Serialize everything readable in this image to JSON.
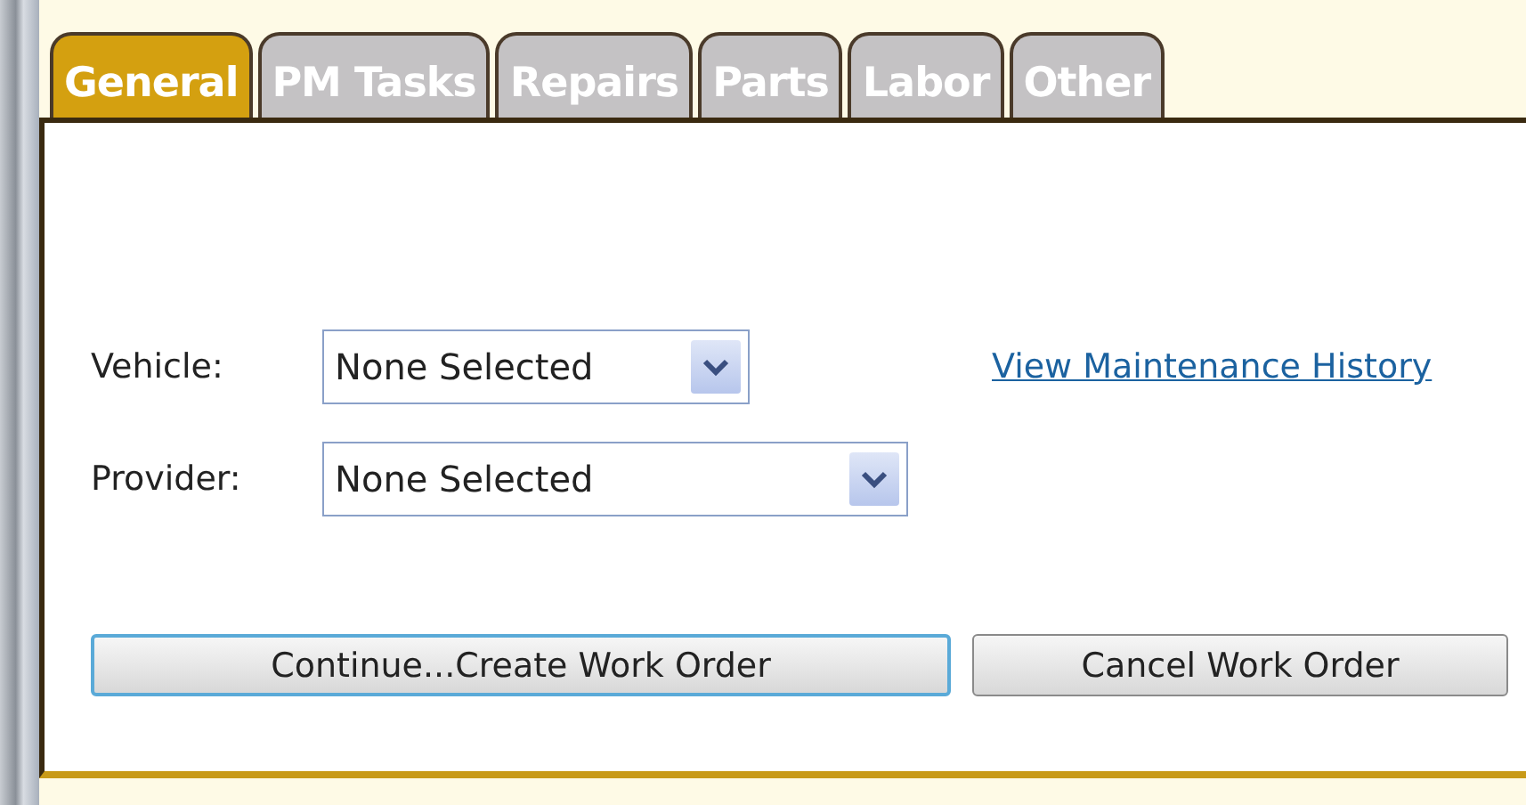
{
  "tabs": [
    {
      "label": "General",
      "selected": true
    },
    {
      "label": "PM Tasks",
      "selected": false
    },
    {
      "label": "Repairs",
      "selected": false
    },
    {
      "label": "Parts",
      "selected": false
    },
    {
      "label": "Labor",
      "selected": false
    },
    {
      "label": "Other",
      "selected": false
    }
  ],
  "fields": [
    {
      "label": "Vehicle:",
      "value": "None Selected",
      "link": "View Maintenance History"
    },
    {
      "label": "Provider:",
      "value": "None Selected"
    }
  ],
  "buttons": [
    {
      "label": "Continue...Create Work Order",
      "focused": true
    },
    {
      "label": "Cancel Work Order",
      "focused": false
    }
  ]
}
